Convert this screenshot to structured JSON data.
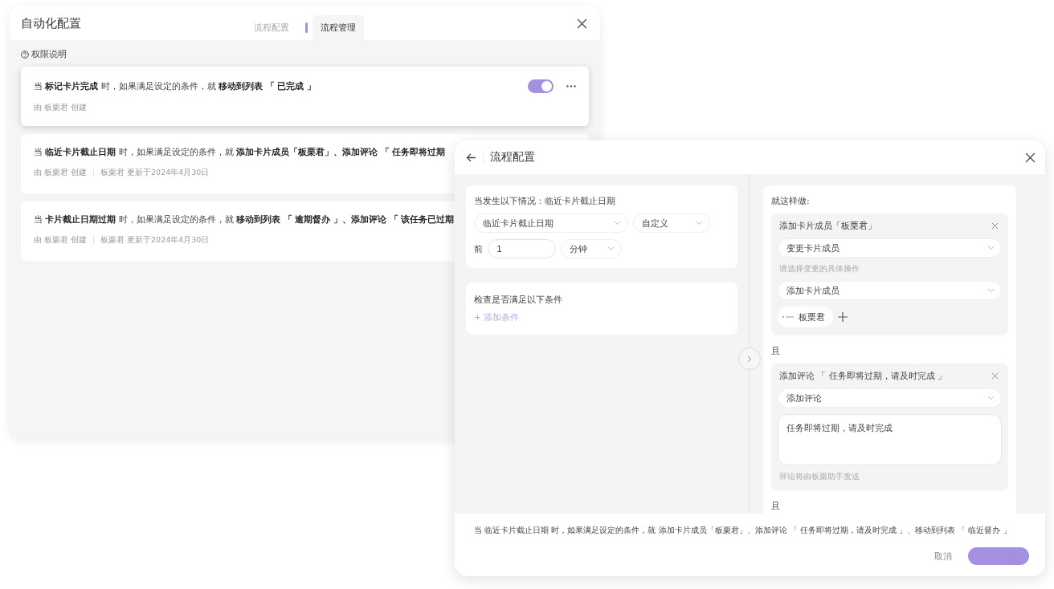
{
  "window_main": {
    "title": "自动化配置",
    "tabs": [
      {
        "label": "流程配置",
        "selected": false
      },
      {
        "label": "流程管理",
        "selected": true
      }
    ],
    "help_link": "权限说明",
    "rules": [
      {
        "text": "当 **标记卡片完成** 时，如果满足设定的条件，就 **移动到列表 「 已完成 」**",
        "meta": [
          "由 板栗君 创建"
        ],
        "selected": true,
        "toggle": {
          "on": true
        }
      },
      {
        "text": "当 **临近卡片截止日期** 时，如果满足设定的条件，就 **添加卡片成员「板栗君」、添加评论 「 任务即将过期**",
        "meta": [
          "由 板栗君 创建",
          "板栗君 更新于2024年4月30日"
        ],
        "selected": false
      },
      {
        "text": "当 **卡片截止日期过期** 时，如果满足设定的条件，就 **移动到列表 「 逾期督办 」、添加评论 「 该任务已过期**",
        "meta": [
          "由 板栗君 创建",
          "板栗君 更新于2024年4月30日"
        ],
        "selected": false
      }
    ]
  },
  "window_flow": {
    "title": "流程配置",
    "trigger": {
      "heading": "当发生以下情况：临近卡片截止日期",
      "event": "临近卡片截止日期",
      "mode": "自定义",
      "prefix": "前",
      "amount": "1",
      "unit": "分钟"
    },
    "conditions": {
      "heading": "检查是否满足以下条件",
      "add_link": "+ 添加条件"
    },
    "actions": {
      "heading": "就这样做:",
      "items": [
        {
          "kind": "member",
          "title": "添加卡片成员「板栗君」",
          "type": "变更卡片成员",
          "sublabel": "请选择变更的具体操作",
          "operation": "添加卡片成员",
          "members": [
            "板栗君"
          ]
        },
        {
          "kind": "comment",
          "connector": "且",
          "title": "添加评论 「 任务即将过期，请及时完成 」",
          "type": "添加评论",
          "comment": "任务即将过期，请及时完成",
          "hint": "评论将由板栗助手发送"
        },
        {
          "kind": "partial",
          "connector": "且"
        }
      ]
    },
    "footer": {
      "summary": "当 临近卡片截止日期 时，如果满足设定的条件，就 添加卡片成员「板栗君」、添加评论 「 任务即将过期，请及时完成 」、移动到列表 「 临近督办 」",
      "buttons": [
        {
          "kind": "cancel",
          "label": "取消"
        },
        {
          "kind": "primary"
        }
      ]
    }
  }
}
